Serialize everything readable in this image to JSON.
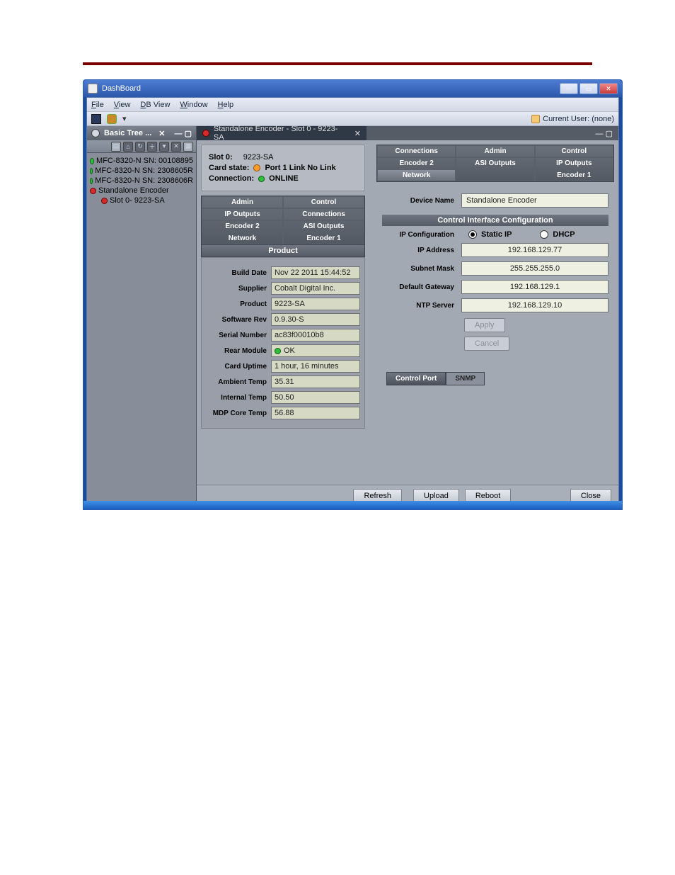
{
  "window": {
    "title": "DashBoard"
  },
  "menus": [
    "File",
    "View",
    "DB View",
    "Window",
    "Help"
  ],
  "current_user_label": "Current User: (none)",
  "left": {
    "title": "Basic Tree ...",
    "items": [
      {
        "text": "MFC-8320-N SN: 00108895",
        "dot": "g"
      },
      {
        "text": "MFC-8320-N SN: 2308605R",
        "dot": "g"
      },
      {
        "text": "MFC-8320-N SN: 2308606R",
        "dot": "g"
      },
      {
        "text": "Standalone Encoder",
        "dot": "r"
      },
      {
        "text": "Slot 0- 9223-SA",
        "dot": "r",
        "indent": true
      }
    ]
  },
  "editor_tab": {
    "title": "Standalone Encoder - Slot 0 - 9223-SA"
  },
  "cardhead": {
    "slot_label": "Slot 0:",
    "slot_val": "9223-SA",
    "state_label": "Card state:",
    "state_val": "Port 1 Link No Link",
    "conn_label": "Connection:",
    "conn_val": "ONLINE"
  },
  "left_tabs": {
    "rows": [
      [
        "Admin",
        "Control"
      ],
      [
        "IP Outputs",
        "Connections"
      ],
      [
        "Encoder 2",
        "ASI Outputs"
      ],
      [
        "Network",
        "Encoder 1"
      ]
    ],
    "active": "Product"
  },
  "product": [
    {
      "k": "Build Date",
      "v": "Nov 22 2011 15:44:52"
    },
    {
      "k": "Supplier",
      "v": "Cobalt Digital Inc."
    },
    {
      "k": "Product",
      "v": "9223-SA"
    },
    {
      "k": "Software Rev",
      "v": "0.9.30-S"
    },
    {
      "k": "Serial Number",
      "v": "ac83f00010b8"
    },
    {
      "k": "Rear Module",
      "v": "OK",
      "status": "ok"
    },
    {
      "k": "Card Uptime",
      "v": "1 hour, 16 minutes"
    },
    {
      "k": "Ambient Temp",
      "v": "35.31"
    },
    {
      "k": "Internal Temp",
      "v": "50.50"
    },
    {
      "k": "MDP Core Temp",
      "v": "56.88"
    }
  ],
  "right_tabs": {
    "rows": [
      [
        "Connections",
        "Admin",
        "Control"
      ],
      [
        "Encoder 2",
        "ASI Outputs",
        "IP Outputs"
      ],
      [
        "Network",
        "",
        "Encoder 1"
      ]
    ],
    "active_row": 2,
    "active_col": 0
  },
  "network": {
    "device_name_label": "Device Name",
    "device_name": "Standalone Encoder",
    "section": "Control Interface Configuration",
    "ipconf_label": "IP Configuration",
    "static": "Static IP",
    "dhcp": "DHCP",
    "selected": "static",
    "fields": [
      {
        "k": "IP Address",
        "v": "192.168.129.77"
      },
      {
        "k": "Subnet Mask",
        "v": "255.255.255.0"
      },
      {
        "k": "Default Gateway",
        "v": "192.168.129.1"
      },
      {
        "k": "NTP Server",
        "v": "192.168.129.10"
      }
    ],
    "apply": "Apply",
    "cancel": "Cancel",
    "bottom_tabs": [
      "Control Port",
      "SNMP"
    ]
  },
  "footer": {
    "refresh": "Refresh",
    "upload": "Upload",
    "reboot": "Reboot",
    "close": "Close"
  }
}
